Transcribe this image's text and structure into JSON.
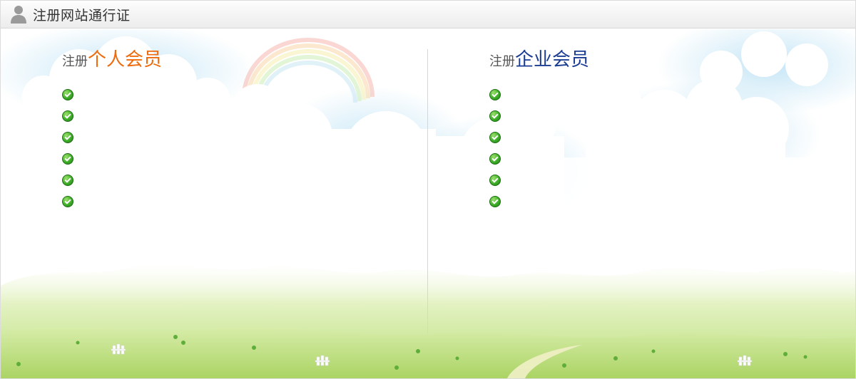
{
  "header": {
    "title": "注册网站通行证",
    "icon": "user-icon"
  },
  "personal": {
    "prefix": "注册",
    "title": "个人会员",
    "color": "#ee6a0c",
    "benefits": [
      "",
      "",
      "",
      "",
      "",
      ""
    ]
  },
  "enterprise": {
    "prefix": "注册",
    "title": "企业会员",
    "color": "#1a3c92",
    "benefits": [
      "",
      "",
      "",
      "",
      "",
      ""
    ]
  },
  "benefit_icon": "check-circle-icon"
}
